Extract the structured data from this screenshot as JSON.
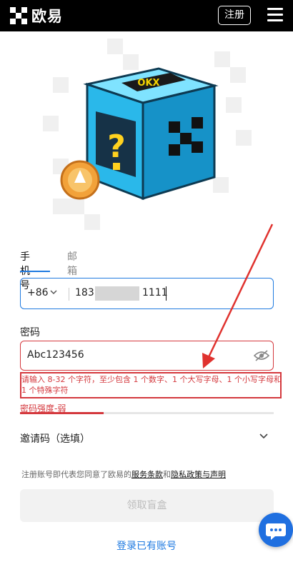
{
  "brand": {
    "name": "欧易"
  },
  "header": {
    "register_label": "注册"
  },
  "tabs": [
    {
      "label": "手机号",
      "active": true
    },
    {
      "label": "邮箱",
      "active": false
    }
  ],
  "phone": {
    "country_code": "+86",
    "prefix": "183",
    "suffix": "1111"
  },
  "password": {
    "label": "密码",
    "value": "Abc123456"
  },
  "password_hint": "请输入 8-32 个字符，至少包含 1 个数字、1 个大写字母、1 个小写字母和 1 个特殊字符",
  "strength": {
    "label": "密码强度-弱",
    "level": 0.33
  },
  "invite": {
    "label": "邀请码（选填）"
  },
  "terms": {
    "prefix": "注册账号即代表您同意了欧易的",
    "link1": "服务条款",
    "joiner": "和",
    "link2": "隐私政策与声明"
  },
  "claim_button": "领取盲盒",
  "login_link": "登录已有账号",
  "colors": {
    "accent": "#1f7ae0",
    "error": "#d4383d",
    "header_bg": "#000000",
    "box_cyan": "#2ec3f0"
  },
  "icons": [
    "okx-logo-icon",
    "hamburger-menu-icon",
    "chevron-down-icon",
    "eye-off-icon",
    "chat-support-icon"
  ]
}
